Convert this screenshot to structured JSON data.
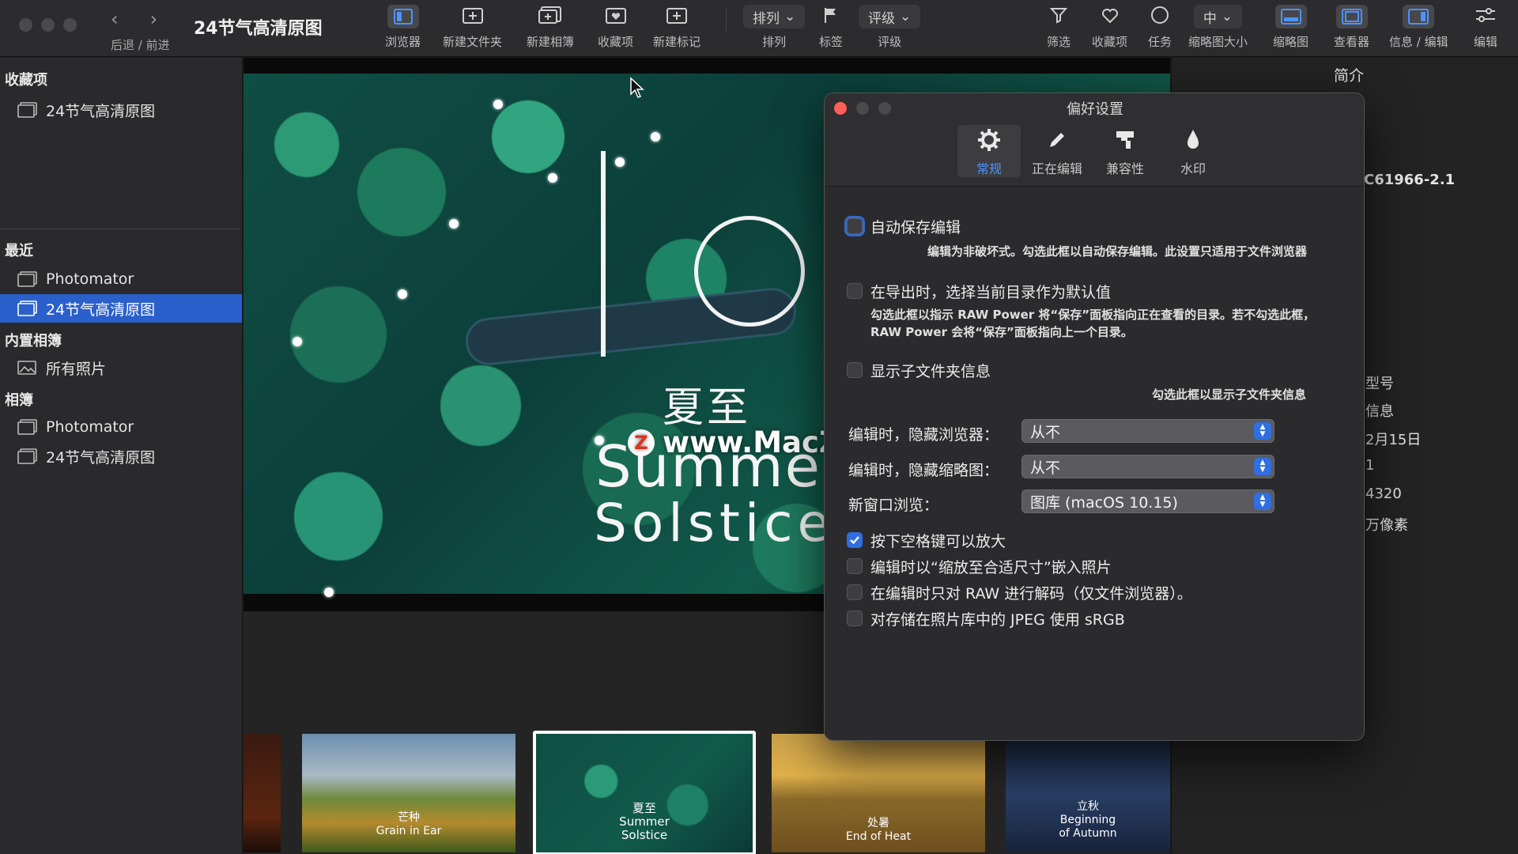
{
  "window": {
    "title": "24节气高清原图",
    "nav_label": "后退 / 前进"
  },
  "toolbar": {
    "browser": "浏览器",
    "new_folder": "新建文件夹",
    "new_album": "新建相簿",
    "favorites": "收藏项",
    "new_tag": "新建标记",
    "sort_popup": "排列",
    "sort": "排列",
    "flag": "标签",
    "rating_popup": "评级",
    "rating": "评级",
    "filter": "筛选",
    "fav": "收藏项",
    "tasks": "任务",
    "thumb_size_popup": "中",
    "thumb_size": "缩略图大小",
    "thumbnails": "缩略图",
    "viewer": "查看器",
    "info_edit": "信息 / 编辑",
    "edit": "编辑"
  },
  "sidebar": {
    "favorites_header": "收藏项",
    "favorites": [
      "24节气高清原图"
    ],
    "recent_header": "最近",
    "recent": [
      "Photomator",
      "24节气高清原图"
    ],
    "builtin_header": "内置相簿",
    "builtin": [
      "所有照片"
    ],
    "albums_header": "相簿",
    "albums": [
      "Photomator",
      "24节气高清原图"
    ]
  },
  "photo": {
    "cn_title": "夏至",
    "en_line1": "Summer",
    "en_line2": "Solstice",
    "watermark_badge": "Z",
    "watermark": "www.MacZ.com"
  },
  "filmstrip": [
    {
      "caption": ""
    },
    {
      "caption": "芒种\nGrain in Ear"
    },
    {
      "caption": "夏至\nSummer\nSolstice"
    },
    {
      "caption": "处暑\nEnd of Heat"
    },
    {
      "caption": "立秋\nBeginning\nof Autumn"
    }
  ],
  "info_panel": {
    "title": "简介",
    "rows": [
      "C61966-2.1",
      "型号",
      "信息",
      "2月15日",
      "1",
      "4320",
      "万像素"
    ]
  },
  "preferences": {
    "title": "偏好设置",
    "tabs": [
      "常规",
      "正在编辑",
      "兼容性",
      "水印"
    ],
    "active_tab": "常规",
    "options": {
      "autosave": "自动保存编辑",
      "autosave_desc": "编辑为非破坏式。勾选此框以自动保存编辑。此设置只适用于文件浏览器",
      "export_dir": "在导出时，选择当前目录作为默认值",
      "export_desc_1": "勾选此框以指示 RAW Power 将“保存”面板指向正在查看的目录。若不勾选此框，",
      "export_desc_2": "RAW Power 会将“保存”面板指向上一个目录。",
      "subfolder": "显示子文件夹信息",
      "subfolder_desc": "勾选此框以显示子文件夹信息",
      "space_zoom": "按下空格键可以放大",
      "fit_embed": "编辑时以“缩放至合适尺寸”嵌入照片",
      "raw_only": "在编辑时只对 RAW 进行解码（仅文件浏览器）。",
      "srgb": "对存储在照片库中的 JPEG 使用 sRGB"
    },
    "checked": {
      "autosave": false,
      "export_dir": false,
      "subfolder": false,
      "space_zoom": true,
      "fit_embed": false,
      "raw_only": false,
      "srgb": false
    },
    "selects": {
      "hide_browser_label": "编辑时，隐藏浏览器：",
      "hide_browser_value": "从不",
      "hide_thumbs_label": "编辑时，隐藏缩略图：",
      "hide_thumbs_value": "从不",
      "new_window_label": "新窗口浏览：",
      "new_window_value": "图库 (macOS 10.15)"
    }
  },
  "colors": {
    "accent": "#2f6fe0",
    "sidebar_selection": "#2b5fcb",
    "close_button": "#ff5f57"
  }
}
